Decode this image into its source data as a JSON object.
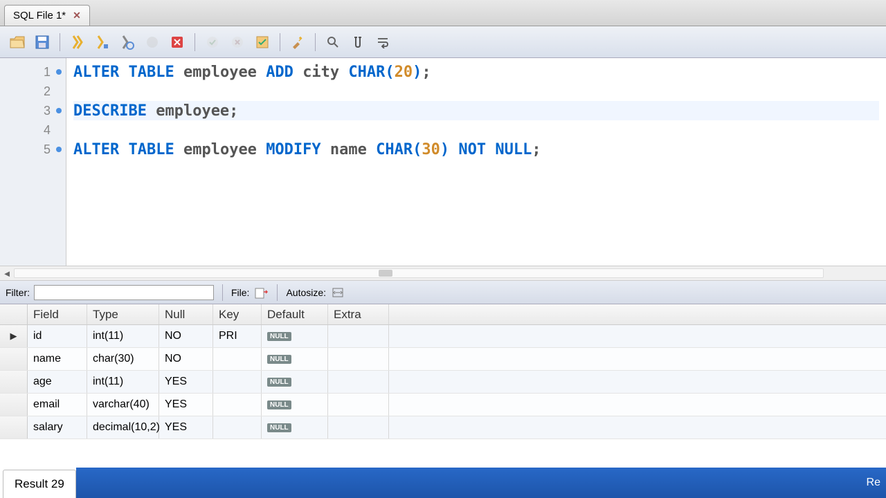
{
  "tab": {
    "title": "SQL File 1*"
  },
  "editor": {
    "lines": [
      {
        "num": "1",
        "dot": true,
        "tokens": [
          {
            "t": "kw",
            "v": "ALTER"
          },
          {
            "t": "sp",
            "v": " "
          },
          {
            "t": "kw",
            "v": "TABLE"
          },
          {
            "t": "sp",
            "v": " "
          },
          {
            "t": "txt",
            "v": "employee"
          },
          {
            "t": "sp",
            "v": " "
          },
          {
            "t": "kw",
            "v": "ADD"
          },
          {
            "t": "sp",
            "v": " "
          },
          {
            "t": "txt",
            "v": "city"
          },
          {
            "t": "sp",
            "v": " "
          },
          {
            "t": "kw",
            "v": "CHAR"
          },
          {
            "t": "kw",
            "v": "("
          },
          {
            "t": "num",
            "v": "20"
          },
          {
            "t": "kw",
            "v": ")"
          },
          {
            "t": "txt",
            "v": ";"
          }
        ]
      },
      {
        "num": "2",
        "dot": false,
        "tokens": []
      },
      {
        "num": "3",
        "dot": true,
        "current": true,
        "tokens": [
          {
            "t": "kw",
            "v": "DESCRIBE"
          },
          {
            "t": "sp",
            "v": " "
          },
          {
            "t": "txt",
            "v": "employee;"
          }
        ]
      },
      {
        "num": "4",
        "dot": false,
        "tokens": []
      },
      {
        "num": "5",
        "dot": true,
        "tokens": [
          {
            "t": "kw",
            "v": "ALTER"
          },
          {
            "t": "sp",
            "v": " "
          },
          {
            "t": "kw",
            "v": "TABLE"
          },
          {
            "t": "sp",
            "v": " "
          },
          {
            "t": "txt",
            "v": "employee"
          },
          {
            "t": "sp",
            "v": " "
          },
          {
            "t": "kw",
            "v": "MODIFY"
          },
          {
            "t": "sp",
            "v": " "
          },
          {
            "t": "txt",
            "v": "name"
          },
          {
            "t": "sp",
            "v": " "
          },
          {
            "t": "kw",
            "v": "CHAR"
          },
          {
            "t": "kw",
            "v": "("
          },
          {
            "t": "num",
            "v": "30"
          },
          {
            "t": "kw",
            "v": ")"
          },
          {
            "t": "sp",
            "v": " "
          },
          {
            "t": "kw",
            "v": "NOT"
          },
          {
            "t": "sp",
            "v": " "
          },
          {
            "t": "kw",
            "v": "NULL"
          },
          {
            "t": "txt",
            "v": ";"
          }
        ]
      }
    ]
  },
  "filterbar": {
    "filter_label": "Filter:",
    "file_label": "File:",
    "autosize_label": "Autosize:"
  },
  "grid": {
    "headers": [
      "Field",
      "Type",
      "Null",
      "Key",
      "Default",
      "Extra"
    ],
    "rows": [
      {
        "field": "id",
        "type": "int(11)",
        "nullv": "NO",
        "key": "PRI",
        "defv": "NULL",
        "extra": ""
      },
      {
        "field": "name",
        "type": "char(30)",
        "nullv": "NO",
        "key": "",
        "defv": "NULL",
        "extra": ""
      },
      {
        "field": "age",
        "type": "int(11)",
        "nullv": "YES",
        "key": "",
        "defv": "NULL",
        "extra": ""
      },
      {
        "field": "email",
        "type": "varchar(40)",
        "nullv": "YES",
        "key": "",
        "defv": "NULL",
        "extra": ""
      },
      {
        "field": "salary",
        "type": "decimal(10,2)",
        "nullv": "YES",
        "key": "",
        "defv": "NULL",
        "extra": ""
      }
    ]
  },
  "status": {
    "result_tab": "Result 29",
    "right": "Re"
  }
}
